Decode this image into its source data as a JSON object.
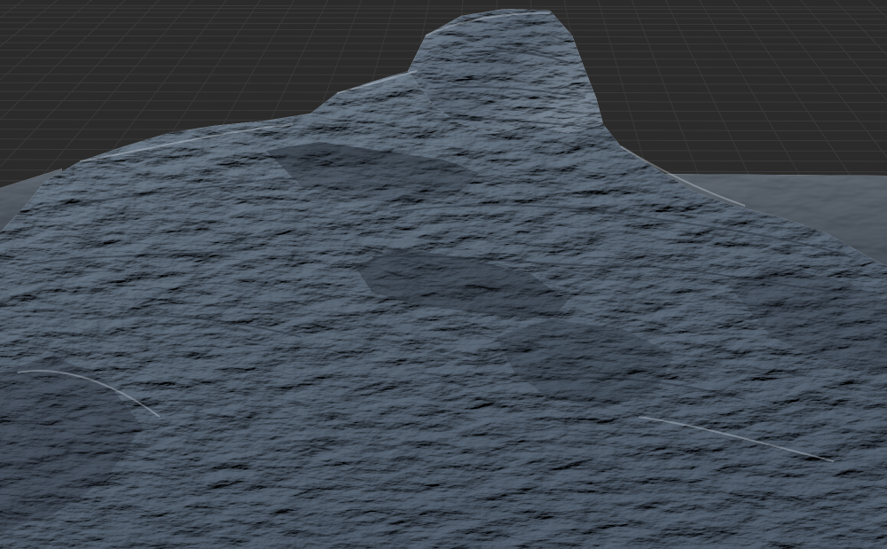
{
  "viewport": {
    "background_color": "#2b2b2b",
    "grid_color": "#3a3a3a",
    "ground_color": "#8d949b",
    "terrain_base_color": "#3e4650",
    "terrain_light_color": "#a9b4bf",
    "terrain_shadow_color": "#1c222a"
  },
  "scene": {
    "object": "terrain-mesh",
    "shading": "matcap",
    "grid_visible": true
  }
}
